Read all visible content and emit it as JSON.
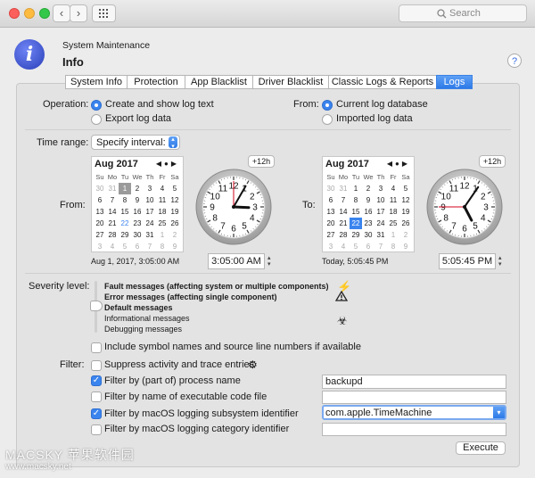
{
  "titlebar": {
    "search_placeholder": "Search"
  },
  "header": {
    "subtitle": "System Maintenance",
    "title": "Info",
    "help": "?"
  },
  "tabs": [
    "System Info",
    "Protection",
    "App Blacklist",
    "Driver Blacklist",
    "Classic Logs & Reports",
    "Logs"
  ],
  "selected_tab": "Logs",
  "operation": {
    "label": "Operation:",
    "options": [
      "Create and show log text",
      "Export log data"
    ],
    "selected": "Create and show log text"
  },
  "from_source": {
    "label": "From:",
    "options": [
      "Current log database",
      "Imported log data"
    ],
    "selected": "Current log database"
  },
  "time_range": {
    "label": "Time range:",
    "value": "Specify interval:"
  },
  "from_panel": {
    "label": "From:",
    "month": "Aug 2017",
    "weekdays": [
      "Su",
      "Mo",
      "Tu",
      "We",
      "Th",
      "Fr",
      "Sa"
    ],
    "weeks": [
      [
        "30",
        "31",
        "1",
        "2",
        "3",
        "4",
        "5"
      ],
      [
        "6",
        "7",
        "8",
        "9",
        "10",
        "11",
        "12"
      ],
      [
        "13",
        "14",
        "15",
        "16",
        "17",
        "18",
        "19"
      ],
      [
        "20",
        "21",
        "22",
        "23",
        "24",
        "25",
        "26"
      ],
      [
        "27",
        "28",
        "29",
        "30",
        "31",
        "1",
        "2"
      ],
      [
        "3",
        "4",
        "5",
        "6",
        "7",
        "8",
        "9"
      ]
    ],
    "plus12": "+12h",
    "summary": "Aug 1, 2017, 3:05:00 AM",
    "time_value": "3:05:00 AM",
    "clock": {
      "hour": 3,
      "minute": 5,
      "second": 0
    }
  },
  "to_panel": {
    "label": "To:",
    "month": "Aug 2017",
    "weekdays": [
      "Su",
      "Mo",
      "Tu",
      "We",
      "Th",
      "Fr",
      "Sa"
    ],
    "weeks": [
      [
        "30",
        "31",
        "1",
        "2",
        "3",
        "4",
        "5"
      ],
      [
        "6",
        "7",
        "8",
        "9",
        "10",
        "11",
        "12"
      ],
      [
        "13",
        "14",
        "15",
        "16",
        "17",
        "18",
        "19"
      ],
      [
        "20",
        "21",
        "22",
        "23",
        "24",
        "25",
        "26"
      ],
      [
        "27",
        "28",
        "29",
        "30",
        "31",
        "1",
        "2"
      ],
      [
        "3",
        "4",
        "5",
        "6",
        "7",
        "8",
        "9"
      ]
    ],
    "plus12": "+12h",
    "summary": "Today, 5:05:45 PM",
    "time_value": "5:05:45 PM",
    "clock": {
      "hour": 5,
      "minute": 5,
      "second": 45
    }
  },
  "clock_numbers": [
    "12",
    "1",
    "2",
    "3",
    "4",
    "5",
    "6",
    "7",
    "8",
    "9",
    "10",
    "11"
  ],
  "severity": {
    "label": "Severity level:",
    "levels": [
      "Fault messages (affecting system or multiple components)",
      "Error messages (affecting single component)",
      "Default messages",
      "Informational messages",
      "Debugging messages"
    ],
    "selected": "Default messages"
  },
  "include_symbols": {
    "label": "Include symbol names and source line numbers if available",
    "checked": false
  },
  "filter": {
    "label": "Filter:",
    "rows": [
      {
        "label": "Suppress activity and trace entries",
        "checked": false,
        "value": ""
      },
      {
        "label": "Filter by (part of) process name",
        "checked": true,
        "value": "backupd"
      },
      {
        "label": "Filter by name of executable code file",
        "checked": false,
        "value": ""
      },
      {
        "label": "Filter by macOS logging subsystem identifier",
        "checked": true,
        "value": "com.apple.TimeMachine"
      },
      {
        "label": "Filter by macOS logging category identifier",
        "checked": false,
        "value": ""
      }
    ]
  },
  "execute_label": "Execute",
  "watermark": {
    "text": "MACSKY 苹果软件园",
    "url": "www.macsky.net"
  },
  "colors": {
    "accent": "#3a84ee",
    "second_hand": "#d0021b"
  }
}
